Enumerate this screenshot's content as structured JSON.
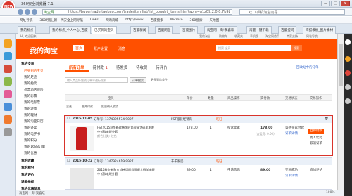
{
  "browser": {
    "title": "360安全浏览器 7.1",
    "addr_tag": "淘宝网",
    "url": "https://buyertrade.taobao.com/trade/itemlist/list_bought_items.htm?spm=a1z09.2.0.0.7b9b1c2bAc&nekot=1470211439696",
    "search_placeholder": "双11手机淘宝向导",
    "favorites": [
      "网址导航",
      "360导航_新一代安全上网导航",
      "Links",
      "网购商城",
      "http://www",
      "百度搜索",
      "Microso",
      "360搜索",
      "天地图"
    ],
    "tabs": [
      "我的标点",
      "我的标点_个人中心_百度",
      "已买到的宝贝",
      "百度新闻",
      "百度网盘",
      "百度图片",
      "淘宝网 - 淘!我喜欢",
      "海量一键下载",
      "百度提问",
      "海报模板_图片素材"
    ]
  },
  "topnav": {
    "left": "Hi, 欢迎回来",
    "right": [
      "我的淘宝",
      "购物车",
      "收藏夹",
      "手机版",
      "淘宝网首页",
      "商家支持",
      "网站导航"
    ]
  },
  "header": {
    "brand": "我的淘宝",
    "nav": [
      "首页",
      "账户设置",
      "消息"
    ],
    "nav_sel": "首页",
    "search_placeholder": "搜索 宝贝",
    "search_btn": "搜索"
  },
  "sidebar": {
    "section1": "我的交易",
    "items": [
      "已买到的宝贝",
      "我的足迹",
      "我的拍卖",
      "机票酒店保险",
      "我的彩票",
      "我的电影票",
      "我的游戏",
      "我的理财",
      "我的淘宝日历",
      "我的外卖",
      "我的电子书",
      "我的积分",
      "我的1688订单",
      "我的优惠"
    ],
    "section2": "我的收藏",
    "section3": "我的积分",
    "section4": "我的评价",
    "section5": "退款维权",
    "section6": "我的优惠信息"
  },
  "order_tabs": {
    "items": [
      {
        "label": "所有订单"
      },
      {
        "label": "待付款",
        "count": "1"
      },
      {
        "label": "待发货"
      },
      {
        "label": "待收货"
      },
      {
        "label": "待评价"
      }
    ],
    "recycle": "回收站中的订单"
  },
  "filter": {
    "placeholder": "输入商品标题或订单号进行搜索",
    "btn": "订单搜索",
    "more": "更多筛选条件"
  },
  "table_head": [
    "宝贝",
    "单价",
    "数量",
    "商品操作",
    "实付款",
    "交易状态",
    "交易操作"
  ],
  "toolbar": [
    "全选",
    "合并付款",
    "批量确认收货"
  ],
  "orders": [
    {
      "date": "2015-11-05",
      "order_no": "订单号: 1374395574 9027",
      "shop": "FST服装经销商",
      "flag": "旺旺",
      "desc": "FST2015秋冬新款韩版时尚显瘦大码羊毛呢中长款毛呢外套",
      "attrs": "颜色分类: 红色",
      "unit_price": "178.00",
      "qty": "1",
      "action": "投诉卖家",
      "paid": "178.00",
      "shipping": "(含运费: 0.00)",
      "status": "等待买家付款",
      "detail": "订单详情",
      "pay_btn": "立即付款",
      "extra1": "找人代付",
      "extra2": "取消订单"
    },
    {
      "date": "2015-10-22",
      "order_no": "订单号: 1347924619 9927",
      "shop": "千千家居",
      "flag": "旺旺",
      "desc": "2015秋冬新款女式韩版时尚显瘦大码羊毛呢中长款毛呢外套",
      "unit_price": "89.00",
      "qty": "1",
      "action": "申请售后",
      "paid": "89.00",
      "status": "交易成功",
      "detail": "订单详情",
      "extra1": "追加评论"
    }
  ],
  "statusbar": {
    "left": "淘宝网 - 淘!我喜欢",
    "right": "100%"
  }
}
